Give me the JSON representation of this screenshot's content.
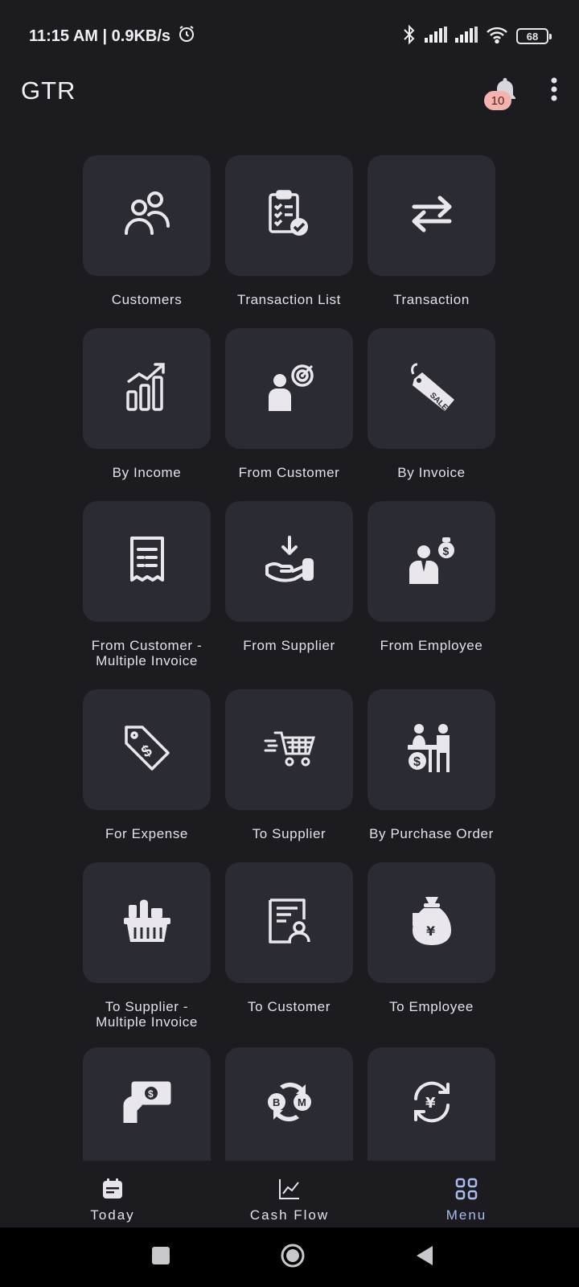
{
  "status_bar": {
    "time_speed": "11:15 AM | 0.9KB/s",
    "battery": "68",
    "icons": [
      "alarm-icon",
      "bluetooth-icon",
      "signal-icon",
      "signal-icon",
      "wifi-icon",
      "battery-icon"
    ]
  },
  "app_bar": {
    "title": "GTR",
    "notification_count": "10",
    "icons": [
      "bell-icon",
      "more-vert-icon"
    ]
  },
  "menu_items": [
    {
      "label": "Customers",
      "icon": "people-icon"
    },
    {
      "label": "Transaction List",
      "icon": "clipboard-check-icon"
    },
    {
      "label": "Transaction",
      "icon": "swap-arrows-icon"
    },
    {
      "label": "By Income",
      "icon": "bar-growth-icon"
    },
    {
      "label": "From Customer",
      "icon": "person-target-icon"
    },
    {
      "label": "By Invoice",
      "icon": "sale-tag-icon"
    },
    {
      "label": "From Customer -\nMultiple Invoice",
      "icon": "receipt-icon"
    },
    {
      "label": "From Supplier",
      "icon": "hand-receive-icon"
    },
    {
      "label": "From Employee",
      "icon": "employee-money-icon"
    },
    {
      "label": "For Expense",
      "icon": "dollar-tag-icon"
    },
    {
      "label": "To Supplier",
      "icon": "fast-cart-icon"
    },
    {
      "label": "By Purchase Order",
      "icon": "counter-payment-icon"
    },
    {
      "label": "To Supplier -\nMultiple Invoice",
      "icon": "grocery-basket-icon"
    },
    {
      "label": "To Customer",
      "icon": "document-person-icon"
    },
    {
      "label": "To Employee",
      "icon": "yen-bag-icon"
    },
    {
      "label": "",
      "icon": "hand-cash-icon"
    },
    {
      "label": "",
      "icon": "currency-exchange-icon"
    },
    {
      "label": "",
      "icon": "yen-cycle-icon"
    }
  ],
  "bottom_nav": {
    "today": "Today",
    "cash_flow": "Cash Flow",
    "menu": "Menu",
    "active": "Menu"
  },
  "colors": {
    "background": "#1c1b20",
    "tile": "#2b2c33",
    "accent": "#a9bdf0",
    "badge": "#f4b4ad"
  }
}
